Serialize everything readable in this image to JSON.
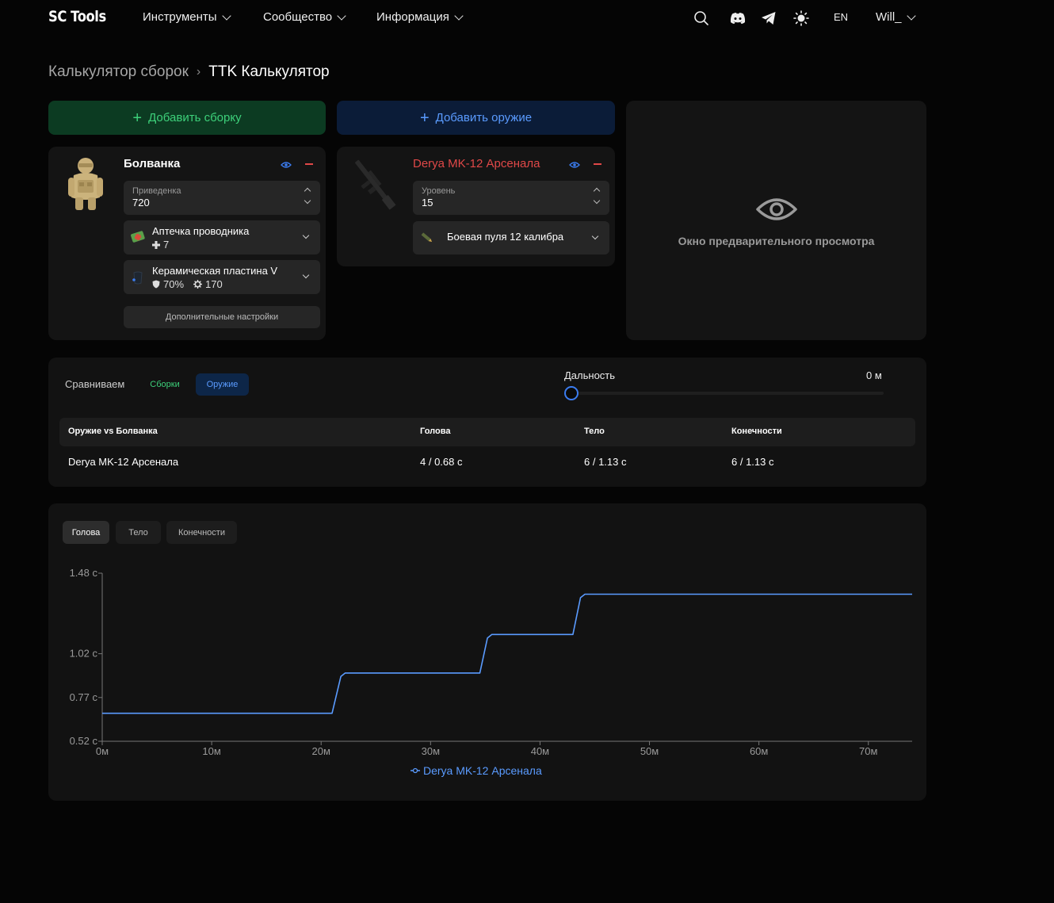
{
  "nav": {
    "logo": "SC Tools",
    "links": [
      "Инструменты",
      "Сообщество",
      "Информация"
    ],
    "lang": "EN",
    "user": "Will_"
  },
  "breadcrumb": {
    "parent": "Калькулятор сборок",
    "sep": "›",
    "current": "TTK Калькулятор"
  },
  "actions": {
    "add_build": "Добавить сборку",
    "add_weapon": "Добавить оружие",
    "plus": "+"
  },
  "build": {
    "name": "Болванка",
    "reduced_label": "Приведенка",
    "reduced_value": "720",
    "medkit_name": "Аптечка проводника",
    "medkit_value": "7",
    "armor_name": "Керамическая пластина V",
    "armor_resist": "70%",
    "armor_durability": "170",
    "advanced": "Дополнительные настройки"
  },
  "weapon": {
    "name": "Derya MK-12 Арсенала",
    "level_label": "Уровень",
    "level_value": "15",
    "ammo": "Боевая пуля 12 калибра"
  },
  "preview": {
    "label": "Окно предварительного просмотра"
  },
  "compare": {
    "label": "Сравниваем",
    "tab_builds": "Сборки",
    "tab_weapons": "Оружие",
    "range_label": "Дальность",
    "range_value": "0 м",
    "range_fraction": 0,
    "headers": [
      "Оружие vs Болванка",
      "Голова",
      "Тело",
      "Конечности"
    ],
    "row": [
      "Derya MK-12 Арсенала",
      "4 / 0.68 с",
      "6 / 1.13 с",
      "6 / 1.13 с"
    ]
  },
  "chart_tabs": [
    "Голова",
    "Тело",
    "Конечности"
  ],
  "colors": {
    "green": "#3dd07a",
    "blue": "#5a9bff",
    "red": "#e04848"
  },
  "chart_data": {
    "type": "line",
    "title": "",
    "xlabel": "",
    "ylabel": "",
    "xlim": [
      0,
      74
    ],
    "ylim": [
      0.52,
      1.48
    ],
    "x_ticks": [
      0,
      10,
      20,
      30,
      40,
      50,
      60,
      70
    ],
    "x_tick_labels": [
      "0м",
      "10м",
      "20м",
      "30м",
      "40м",
      "50м",
      "60м",
      "70м"
    ],
    "y_ticks": [
      0.52,
      0.77,
      1.02,
      1.48
    ],
    "y_tick_labels": [
      "0.52 с",
      "0.77 с",
      "1.02 с",
      "1.48 с"
    ],
    "legend": "bottom",
    "grid": false,
    "series": [
      {
        "name": "Derya MK-12 Арсенала",
        "color": "#5a9bff",
        "x": [
          0,
          21.0,
          21.8,
          22.2,
          34.5,
          35.2,
          35.6,
          43.0,
          43.7,
          44.1,
          74
        ],
        "y": [
          0.68,
          0.68,
          0.89,
          0.91,
          0.91,
          1.11,
          1.13,
          1.13,
          1.34,
          1.36,
          1.36
        ]
      }
    ]
  }
}
